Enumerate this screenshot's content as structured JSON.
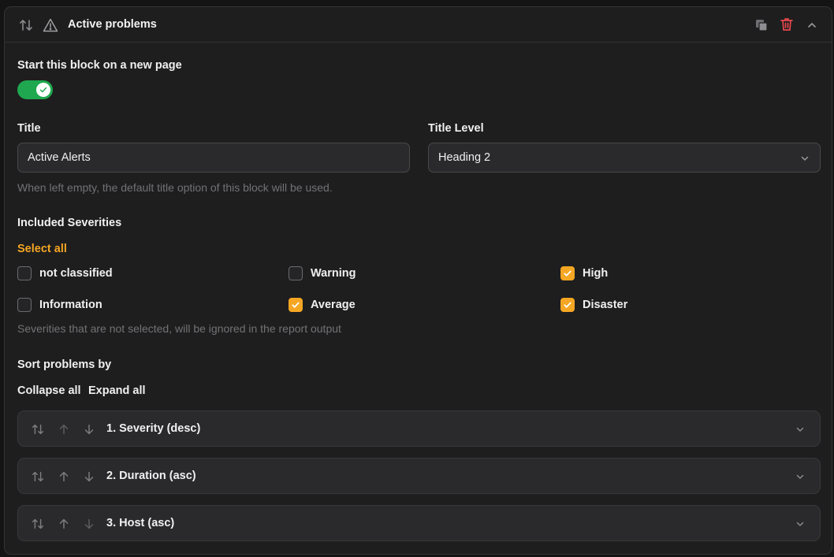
{
  "block": {
    "title": "Active problems",
    "icons": {
      "reorder": "swap-vertical-icon",
      "warning": "warning-triangle-icon",
      "copy": "copy-icon",
      "delete": "trash-icon",
      "collapse": "chevron-up-icon"
    }
  },
  "new_page": {
    "label": "Start this block on a new page",
    "enabled": true
  },
  "title_field": {
    "label": "Title",
    "value": "Active Alerts",
    "hint": "When left empty, the default title option of this block will be used."
  },
  "title_level": {
    "label": "Title Level",
    "value": "Heading 2"
  },
  "severities": {
    "label": "Included Severities",
    "select_all": "Select all",
    "hint": "Severities that are not selected, will be ignored in the report output",
    "items": [
      {
        "label": "not classified",
        "checked": false
      },
      {
        "label": "Warning",
        "checked": false
      },
      {
        "label": "High",
        "checked": true
      },
      {
        "label": "Information",
        "checked": false
      },
      {
        "label": "Average",
        "checked": true
      },
      {
        "label": "Disaster",
        "checked": true
      }
    ]
  },
  "sort": {
    "label": "Sort problems by",
    "collapse_all": "Collapse all",
    "expand_all": "Expand all",
    "items": [
      {
        "label": "1. Severity (desc)"
      },
      {
        "label": "2. Duration (asc)"
      },
      {
        "label": "3. Host (asc)"
      }
    ]
  },
  "colors": {
    "accent": "#f5a623",
    "toggle_on": "#1fa84f",
    "delete": "#e5484d"
  }
}
